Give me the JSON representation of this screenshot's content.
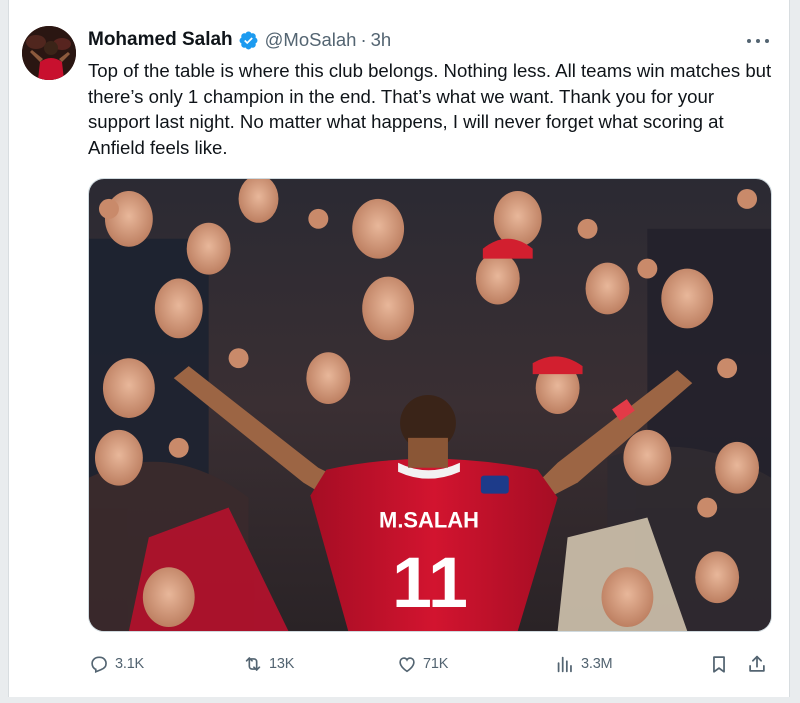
{
  "tweet": {
    "author_name": "Mohamed Salah",
    "handle": "@MoSalah",
    "separator": "·",
    "time": "3h",
    "text": "Top of the table is where this club belongs. Nothing less. All teams win matches but there’s only 1 champion in the end. That’s what we want. Thank you for your support last night. No matter what happens, I will never forget what scoring at Anfield feels like.",
    "media": {
      "shirt_name": "M.SALAH",
      "shirt_number": "11"
    }
  },
  "actions": {
    "replies": "3.1K",
    "reposts": "13K",
    "likes": "71K",
    "views": "3.3M"
  },
  "icons": {
    "verified": "verified-badge-icon",
    "more": "more-options-icon",
    "reply": "reply-icon",
    "repost": "repost-icon",
    "like": "heart-icon",
    "views": "views-chart-icon",
    "bookmark": "bookmark-icon",
    "share": "share-icon"
  },
  "colors": {
    "verified_blue": "#1d9bf0",
    "secondary_text": "#536471",
    "primary_text": "#0f1419",
    "kit_red": "#c8102e"
  }
}
